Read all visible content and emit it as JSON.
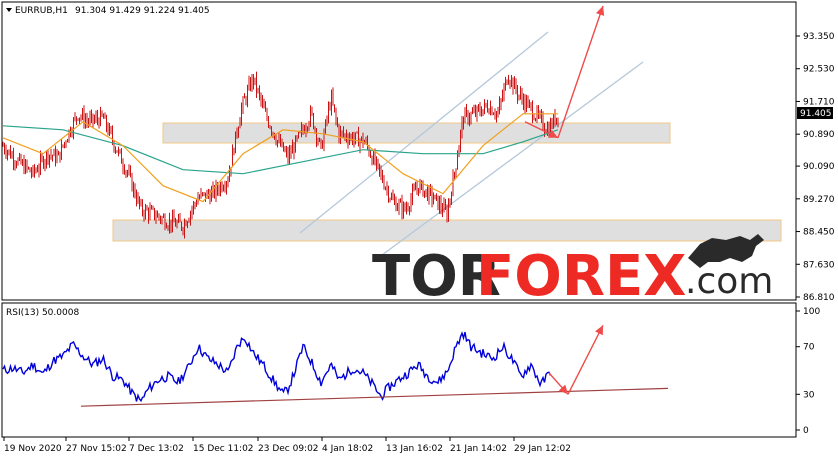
{
  "header": {
    "symbol_label": "EURRUB,H1",
    "ohlc_label": "91.304 91.429 91.224 91.405"
  },
  "rsi_header": "RSI(13) 50.0008",
  "current_price_label": "91.405",
  "watermark": {
    "part1": "TOR",
    "part2": "FOREX",
    "part3": ".com"
  },
  "colors": {
    "candle": "#c81414",
    "ma_slow": "#2aa48c",
    "ma_fast": "#f0a020",
    "rsi_line": "#0000d8",
    "arrow": "#f04a4a",
    "channel": "#b4c8dc",
    "zone_fill": "#dcdcdc",
    "zone_border": "#f0c27a",
    "rsi_trend": "#a04040",
    "brand_red": "#ee2a24"
  },
  "chart_data": [
    {
      "type": "candlestick",
      "title": "EURRUB,H1",
      "ylim": [
        86.5,
        94.4
      ],
      "y_ticks": [
        "93.350",
        "92.530",
        "91.710",
        "90.890",
        "90.090",
        "89.270",
        "88.450",
        "87.630",
        "86.810"
      ],
      "current_price": 91.405,
      "support_zone": [
        88.3,
        88.8
      ],
      "resistance_zone": [
        90.8,
        91.2
      ],
      "close_path_points": [
        [
          0,
          90.6
        ],
        [
          15,
          90.2
        ],
        [
          30,
          89.9
        ],
        [
          45,
          90.4
        ],
        [
          55,
          90.3
        ],
        [
          65,
          90.9
        ],
        [
          75,
          91.4
        ],
        [
          85,
          91.2
        ],
        [
          100,
          91.3
        ],
        [
          112,
          90.6
        ],
        [
          125,
          89.9
        ],
        [
          138,
          89.0
        ],
        [
          150,
          88.9
        ],
        [
          165,
          88.7
        ],
        [
          180,
          88.6
        ],
        [
          195,
          89.3
        ],
        [
          210,
          89.4
        ],
        [
          225,
          89.8
        ],
        [
          238,
          91.5
        ],
        [
          250,
          92.3
        ],
        [
          262,
          91.4
        ],
        [
          275,
          90.7
        ],
        [
          285,
          90.3
        ],
        [
          298,
          90.9
        ],
        [
          308,
          91.4
        ],
        [
          318,
          90.5
        ],
        [
          328,
          91.8
        ],
        [
          336,
          90.9
        ],
        [
          350,
          90.8
        ],
        [
          362,
          90.7
        ],
        [
          375,
          90.0
        ],
        [
          390,
          89.2
        ],
        [
          402,
          89.0
        ],
        [
          415,
          89.6
        ],
        [
          430,
          89.3
        ],
        [
          444,
          88.9
        ],
        [
          452,
          90.0
        ],
        [
          460,
          91.3
        ],
        [
          472,
          91.4
        ],
        [
          485,
          91.6
        ],
        [
          495,
          91.4
        ],
        [
          505,
          92.4
        ],
        [
          515,
          91.9
        ],
        [
          525,
          91.6
        ],
        [
          535,
          91.3
        ],
        [
          545,
          91.0
        ],
        [
          555,
          91.4
        ]
      ],
      "ma_fast_points": [
        [
          0,
          90.8
        ],
        [
          40,
          90.4
        ],
        [
          80,
          91.2
        ],
        [
          120,
          90.6
        ],
        [
          160,
          89.6
        ],
        [
          200,
          89.2
        ],
        [
          240,
          90.4
        ],
        [
          280,
          91.0
        ],
        [
          320,
          90.9
        ],
        [
          360,
          90.7
        ],
        [
          400,
          89.9
        ],
        [
          440,
          89.4
        ],
        [
          480,
          90.6
        ],
        [
          520,
          91.4
        ],
        [
          555,
          91.4
        ]
      ],
      "ma_slow_points": [
        [
          0,
          91.1
        ],
        [
          60,
          91.0
        ],
        [
          120,
          90.6
        ],
        [
          180,
          90.0
        ],
        [
          240,
          89.9
        ],
        [
          300,
          90.2
        ],
        [
          360,
          90.5
        ],
        [
          420,
          90.4
        ],
        [
          480,
          90.4
        ],
        [
          520,
          90.7
        ],
        [
          555,
          91.0
        ]
      ],
      "forecast_arrows": [
        {
          "from": [
            522,
            91.2
          ],
          "to": [
            555,
            90.8
          ]
        },
        {
          "from": [
            555,
            90.8
          ],
          "to": [
            600,
            94.4
          ]
        }
      ],
      "x_tick_labels": [
        "19 Nov 2020",
        "27 Nov 15:02",
        "7 Dec 13:02",
        "15 Dec 11:02",
        "23 Dec 09:02",
        "4 Jan 18:02",
        "13 Jan 16:02",
        "21 Jan 14:02",
        "29 Jan 12:02"
      ]
    },
    {
      "type": "line",
      "title": "RSI(13) 50.0008",
      "ylim": [
        0,
        100
      ],
      "y_ticks": [
        "100",
        "70",
        "30",
        "0"
      ],
      "rsi_points": [
        [
          0,
          50
        ],
        [
          10,
          52
        ],
        [
          20,
          48
        ],
        [
          30,
          55
        ],
        [
          40,
          47
        ],
        [
          50,
          58
        ],
        [
          60,
          62
        ],
        [
          70,
          72
        ],
        [
          80,
          62
        ],
        [
          90,
          55
        ],
        [
          100,
          60
        ],
        [
          110,
          45
        ],
        [
          120,
          42
        ],
        [
          130,
          30
        ],
        [
          138,
          24
        ],
        [
          145,
          34
        ],
        [
          155,
          42
        ],
        [
          165,
          45
        ],
        [
          175,
          40
        ],
        [
          185,
          52
        ],
        [
          195,
          70
        ],
        [
          205,
          60
        ],
        [
          215,
          55
        ],
        [
          225,
          48
        ],
        [
          235,
          72
        ],
        [
          242,
          78
        ],
        [
          250,
          65
        ],
        [
          260,
          55
        ],
        [
          270,
          42
        ],
        [
          280,
          30
        ],
        [
          285,
          35
        ],
        [
          290,
          45
        ],
        [
          300,
          70
        ],
        [
          308,
          58
        ],
        [
          318,
          40
        ],
        [
          328,
          55
        ],
        [
          336,
          42
        ],
        [
          350,
          52
        ],
        [
          360,
          48
        ],
        [
          370,
          38
        ],
        [
          378,
          28
        ],
        [
          385,
          35
        ],
        [
          395,
          42
        ],
        [
          405,
          48
        ],
        [
          415,
          55
        ],
        [
          425,
          45
        ],
        [
          435,
          40
        ],
        [
          445,
          50
        ],
        [
          452,
          68
        ],
        [
          460,
          82
        ],
        [
          468,
          70
        ],
        [
          478,
          65
        ],
        [
          490,
          60
        ],
        [
          500,
          70
        ],
        [
          510,
          58
        ],
        [
          518,
          45
        ],
        [
          528,
          55
        ],
        [
          538,
          38
        ],
        [
          548,
          50
        ]
      ],
      "trend_line": {
        "from": [
          78,
          20
        ],
        "to": [
          665,
          35
        ]
      },
      "forecast_arrows": [
        {
          "from": [
            546,
            48
          ],
          "to": [
            565,
            30
          ]
        },
        {
          "from": [
            565,
            30
          ],
          "to": [
            600,
            88
          ]
        }
      ]
    }
  ]
}
